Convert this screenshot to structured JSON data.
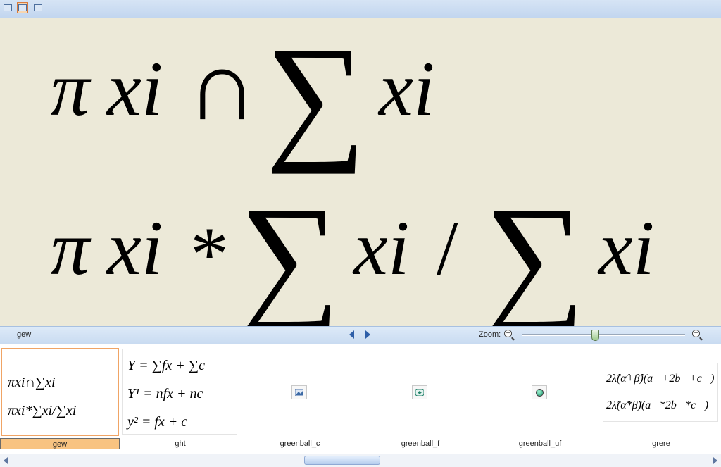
{
  "toolbar": {
    "buttons": [
      {
        "icon": "thumbnail-view-icon"
      },
      {
        "icon": "filmstrip-view-icon",
        "active": true
      },
      {
        "icon": "slideshow-view-icon"
      }
    ]
  },
  "preview": {
    "line1": [
      "π",
      "xi",
      "∩",
      "∑",
      "xi"
    ],
    "line2": [
      "π",
      "xi",
      "*",
      "∑",
      "xi",
      "/",
      "∑",
      "xi"
    ]
  },
  "status": {
    "current_name": "gew",
    "prev_icon": "previous-arrow-icon",
    "next_icon": "next-arrow-icon",
    "zoom_label": "Zoom:",
    "zoom_out_icon": "zoom-out-icon",
    "zoom_in_icon": "zoom-in-icon",
    "zoom_level_fraction": 0.45
  },
  "thumbnails": [
    {
      "name": "gew",
      "selected": true,
      "lines": [
        "πxi∩∑xi",
        "πxi*∑xi/∑xi"
      ]
    },
    {
      "name": "ght",
      "selected": false,
      "lines": [
        "Y = ∑fx + ∑c",
        "Y¹ = nfx + nc",
        "y² = fx + c"
      ]
    },
    {
      "name": "greenball_c",
      "selected": false,
      "icon": "image-file-icon"
    },
    {
      "name": "greenball_f",
      "selected": false,
      "icon": "image-file-icon"
    },
    {
      "name": "greenball_uf",
      "selected": false,
      "icon": "green-ball-icon"
    },
    {
      "name": "grere",
      "selected": false,
      "lines": [
        "2λ̂(α̂+β̂)(a⃗+2b⃗+c⃗)",
        "2λ̂(α̂*β̂)(a⃗*2b⃗*c⃗)"
      ]
    }
  ],
  "scrollbar": {
    "left_icon": "scroll-left-icon",
    "right_icon": "scroll-right-icon",
    "position_fraction": 0.47
  }
}
